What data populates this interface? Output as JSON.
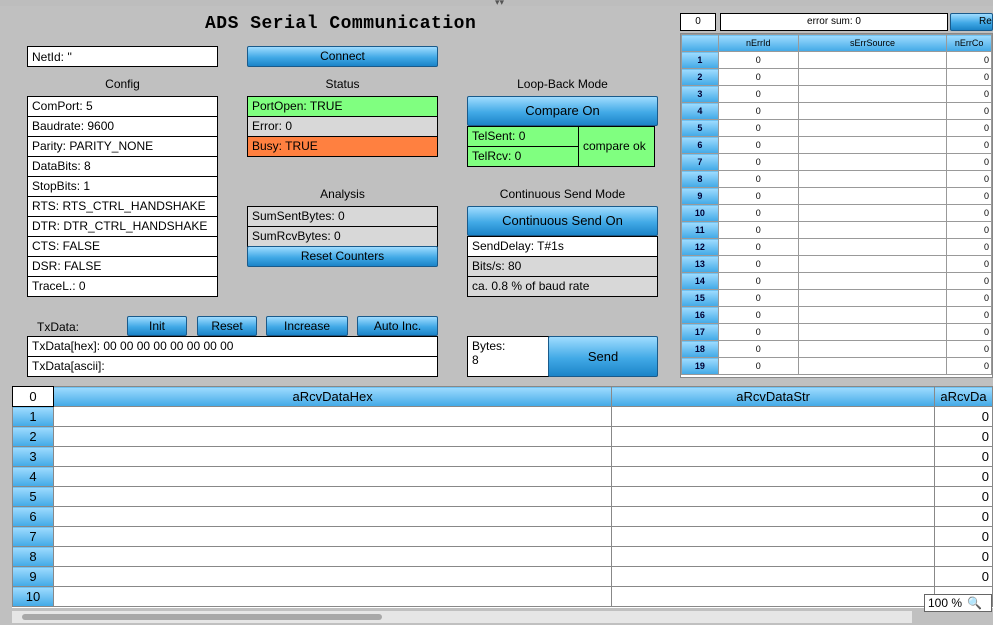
{
  "title": "ADS Serial Communication",
  "netid": "NetId: ''",
  "connect_label": "Connect",
  "config": {
    "header": "Config",
    "rows": [
      "ComPort: 5",
      "Baudrate: 9600",
      "Parity:      PARITY_NONE",
      "DataBits:  8",
      "StopBits:  1",
      "RTS:    RTS_CTRL_HANDSHAKE",
      "DTR:    DTR_CTRL_HANDSHAKE",
      "CTS:    FALSE",
      "DSR:    FALSE",
      "TraceL.:  0"
    ]
  },
  "status": {
    "header": "Status",
    "port_open": "PortOpen: TRUE",
    "error": "Error:    0",
    "busy": "Busy:     TRUE"
  },
  "analysis": {
    "header": "Analysis",
    "sum_sent": "SumSentBytes: 0",
    "sum_rcv": "SumRcvBytes:   0",
    "reset_label": "Reset Counters"
  },
  "loopback": {
    "header": "Loop-Back Mode",
    "compare_label": "Compare On",
    "tel_sent": "TelSent: 0",
    "tel_rcv": "TelRcv:   0",
    "compare_status": "compare ok"
  },
  "continuous": {
    "header": "Continuous Send Mode",
    "button_label": "Continuous Send On",
    "send_delay": "SendDelay: T#1s",
    "bits_per_s": "Bits/s:      80",
    "baud_rate": "ca. 0.8 % of baud rate"
  },
  "txdata": {
    "label": "TxData:",
    "init_label": "Init",
    "reset_label": "Reset",
    "increase_label": "Increase",
    "autoinc_label": "Auto Inc.",
    "hex": "TxData[hex]:   00 00 00 00 00 00 00 00",
    "ascii": "TxData[ascii]:"
  },
  "send": {
    "bytes_label": "Bytes:",
    "bytes_value": "8",
    "send_label": "Send"
  },
  "errors": {
    "index": "0",
    "error_sum": "error sum: 0",
    "reset_partial": "Re",
    "columns": [
      "nErrId",
      "sErrSource",
      "nErrCo"
    ],
    "rows": [
      {
        "n": "1",
        "id": "0",
        "src": "",
        "co": "0"
      },
      {
        "n": "2",
        "id": "0",
        "src": "",
        "co": "0"
      },
      {
        "n": "3",
        "id": "0",
        "src": "",
        "co": "0"
      },
      {
        "n": "4",
        "id": "0",
        "src": "",
        "co": "0"
      },
      {
        "n": "5",
        "id": "0",
        "src": "",
        "co": "0"
      },
      {
        "n": "6",
        "id": "0",
        "src": "",
        "co": "0"
      },
      {
        "n": "7",
        "id": "0",
        "src": "",
        "co": "0"
      },
      {
        "n": "8",
        "id": "0",
        "src": "",
        "co": "0"
      },
      {
        "n": "9",
        "id": "0",
        "src": "",
        "co": "0"
      },
      {
        "n": "10",
        "id": "0",
        "src": "",
        "co": "0"
      },
      {
        "n": "11",
        "id": "0",
        "src": "",
        "co": "0"
      },
      {
        "n": "12",
        "id": "0",
        "src": "",
        "co": "0"
      },
      {
        "n": "13",
        "id": "0",
        "src": "",
        "co": "0"
      },
      {
        "n": "14",
        "id": "0",
        "src": "",
        "co": "0"
      },
      {
        "n": "15",
        "id": "0",
        "src": "",
        "co": "0"
      },
      {
        "n": "16",
        "id": "0",
        "src": "",
        "co": "0"
      },
      {
        "n": "17",
        "id": "0",
        "src": "",
        "co": "0"
      },
      {
        "n": "18",
        "id": "0",
        "src": "",
        "co": "0"
      },
      {
        "n": "19",
        "id": "0",
        "src": "",
        "co": "0"
      }
    ]
  },
  "receive": {
    "index": "0",
    "columns": [
      "aRcvDataHex",
      "aRcvDataStr",
      "aRcvDa"
    ],
    "rows": [
      {
        "n": "1",
        "hex": "",
        "str": "",
        "val": "0"
      },
      {
        "n": "2",
        "hex": "",
        "str": "",
        "val": "0"
      },
      {
        "n": "3",
        "hex": "",
        "str": "",
        "val": "0"
      },
      {
        "n": "4",
        "hex": "",
        "str": "",
        "val": "0"
      },
      {
        "n": "5",
        "hex": "",
        "str": "",
        "val": "0"
      },
      {
        "n": "6",
        "hex": "",
        "str": "",
        "val": "0"
      },
      {
        "n": "7",
        "hex": "",
        "str": "",
        "val": "0"
      },
      {
        "n": "8",
        "hex": "",
        "str": "",
        "val": "0"
      },
      {
        "n": "9",
        "hex": "",
        "str": "",
        "val": "0"
      },
      {
        "n": "10",
        "hex": "",
        "str": "",
        "val": ""
      }
    ]
  },
  "zoom": "100 %",
  "icons": {
    "zoom": "magnifier-icon"
  },
  "colors": {
    "ok": "#80ff80",
    "busy": "#ff8040",
    "button": "#41a9e6"
  }
}
